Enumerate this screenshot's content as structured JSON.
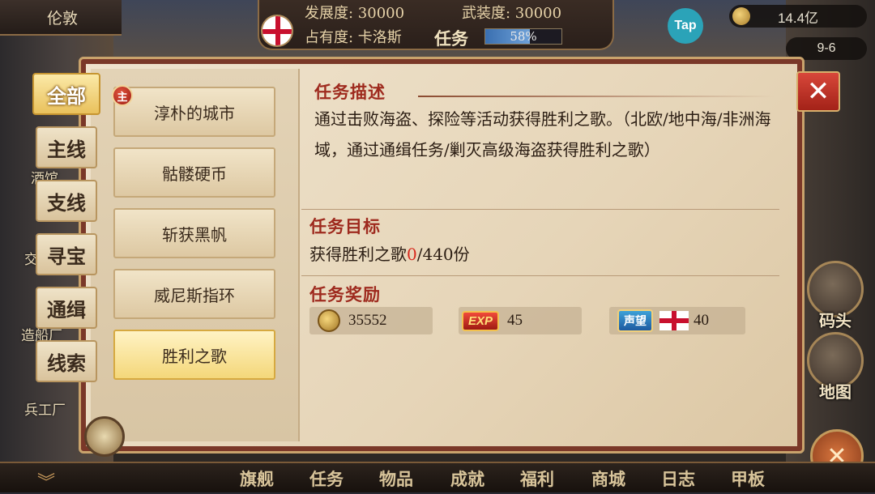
{
  "hud": {
    "city": "伦敦",
    "development": "发展度: 30000",
    "armament": "武装度: 30000",
    "occupation": "占有度: 卡洛斯",
    "task_label": "任务",
    "progress_text": "58%",
    "progress_value": 0.58,
    "tap": "Tap",
    "gold": "14.4亿",
    "level": "9-6"
  },
  "categories": [
    {
      "label": "全部",
      "active": true
    },
    {
      "label": "主线",
      "active": false
    },
    {
      "label": "支线",
      "active": false
    },
    {
      "label": "寻宝",
      "active": false
    },
    {
      "label": "通缉",
      "active": false
    },
    {
      "label": "线索",
      "active": false
    }
  ],
  "quests": [
    {
      "label": "淳朴的城市",
      "badge": "主"
    },
    {
      "label": "骷髅硬币"
    },
    {
      "label": "斩获黑帆"
    },
    {
      "label": "威尼斯指环"
    },
    {
      "label": "胜利之歌",
      "active": true
    }
  ],
  "detail": {
    "desc_heading": "任务描述",
    "description": "通过击败海盗、探险等活动获得胜利之歌。（北欧/地中海/非洲海域，通过通缉任务/剿灭高级海盗获得胜利之歌）",
    "goal_heading": "任务目标",
    "goal_prefix": "获得胜利之歌",
    "goal_current": "0",
    "goal_suffix": "/440份",
    "reward_heading": "任务奖励",
    "rewards": {
      "gold": "35552",
      "exp_badge": "EXP",
      "exp": "45",
      "fame_badge": "声望",
      "fame": "40"
    }
  },
  "side_nav": {
    "dock": "码头",
    "map": "地图"
  },
  "left_deco": {
    "tavern": "酒馆",
    "trade": "交",
    "shipyard": "造船厂",
    "arsenal": "兵工厂"
  },
  "bottom_nav": [
    "旗舰",
    "任务",
    "物品",
    "成就",
    "福利",
    "商城",
    "日志",
    "甲板"
  ],
  "colors": {
    "accent_red": "#9e2a1e",
    "goal_red": "#d82a1e",
    "parchment": "#efe3cd",
    "frame": "#7a3828"
  }
}
